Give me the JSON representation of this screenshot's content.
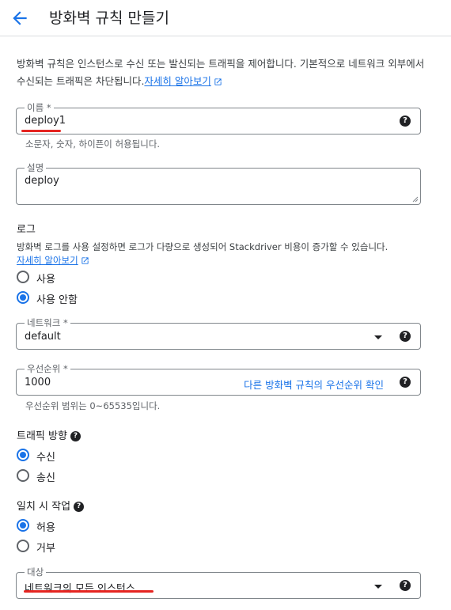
{
  "header": {
    "title": "방화벽 규칙 만들기"
  },
  "intro": {
    "text": "방화벽 규칙은 인스턴스로 수신 또는 발신되는 트래픽을 제어합니다. 기본적으로 네트워크 외부에서 수신되는 트래픽은 차단됩니다.",
    "link": "자세히 알아보기"
  },
  "name_field": {
    "label": "이름 *",
    "value": "deploy1",
    "hint": "소문자, 숫자, 하이픈이 허용됩니다."
  },
  "desc_field": {
    "label": "설명",
    "value": "deploy"
  },
  "logs": {
    "heading": "로그",
    "text": "방화벽 로그를 사용 설정하면 로그가 다량으로 생성되어 Stackdriver 비용이 증가할 수 있습니다.",
    "link": "자세히 알아보기",
    "options": [
      "사용",
      "사용 안함"
    ],
    "selected": "사용 안함"
  },
  "network_field": {
    "label": "네트워크 *",
    "value": "default"
  },
  "priority_field": {
    "label": "우선순위 *",
    "value": "1000",
    "link": "다른 방화벽 규칙의 우선순위 확인",
    "hint": "우선순위 범위는 0~65535입니다."
  },
  "direction": {
    "heading": "트래픽 방향",
    "options": [
      "수신",
      "송신"
    ],
    "selected": "수신"
  },
  "action": {
    "heading": "일치 시 작업",
    "options": [
      "허용",
      "거부"
    ],
    "selected": "허용"
  },
  "target_field": {
    "label": "대상",
    "value": "네트워크의 모든 인스턴스"
  },
  "colors": {
    "accent": "#1a73e8",
    "annotation": "#e52521",
    "border": "#80868b"
  },
  "icons": {
    "back": "arrow-back-icon",
    "help": "help-icon",
    "external": "open-in-new-icon",
    "dropdown": "dropdown-arrow-icon"
  }
}
